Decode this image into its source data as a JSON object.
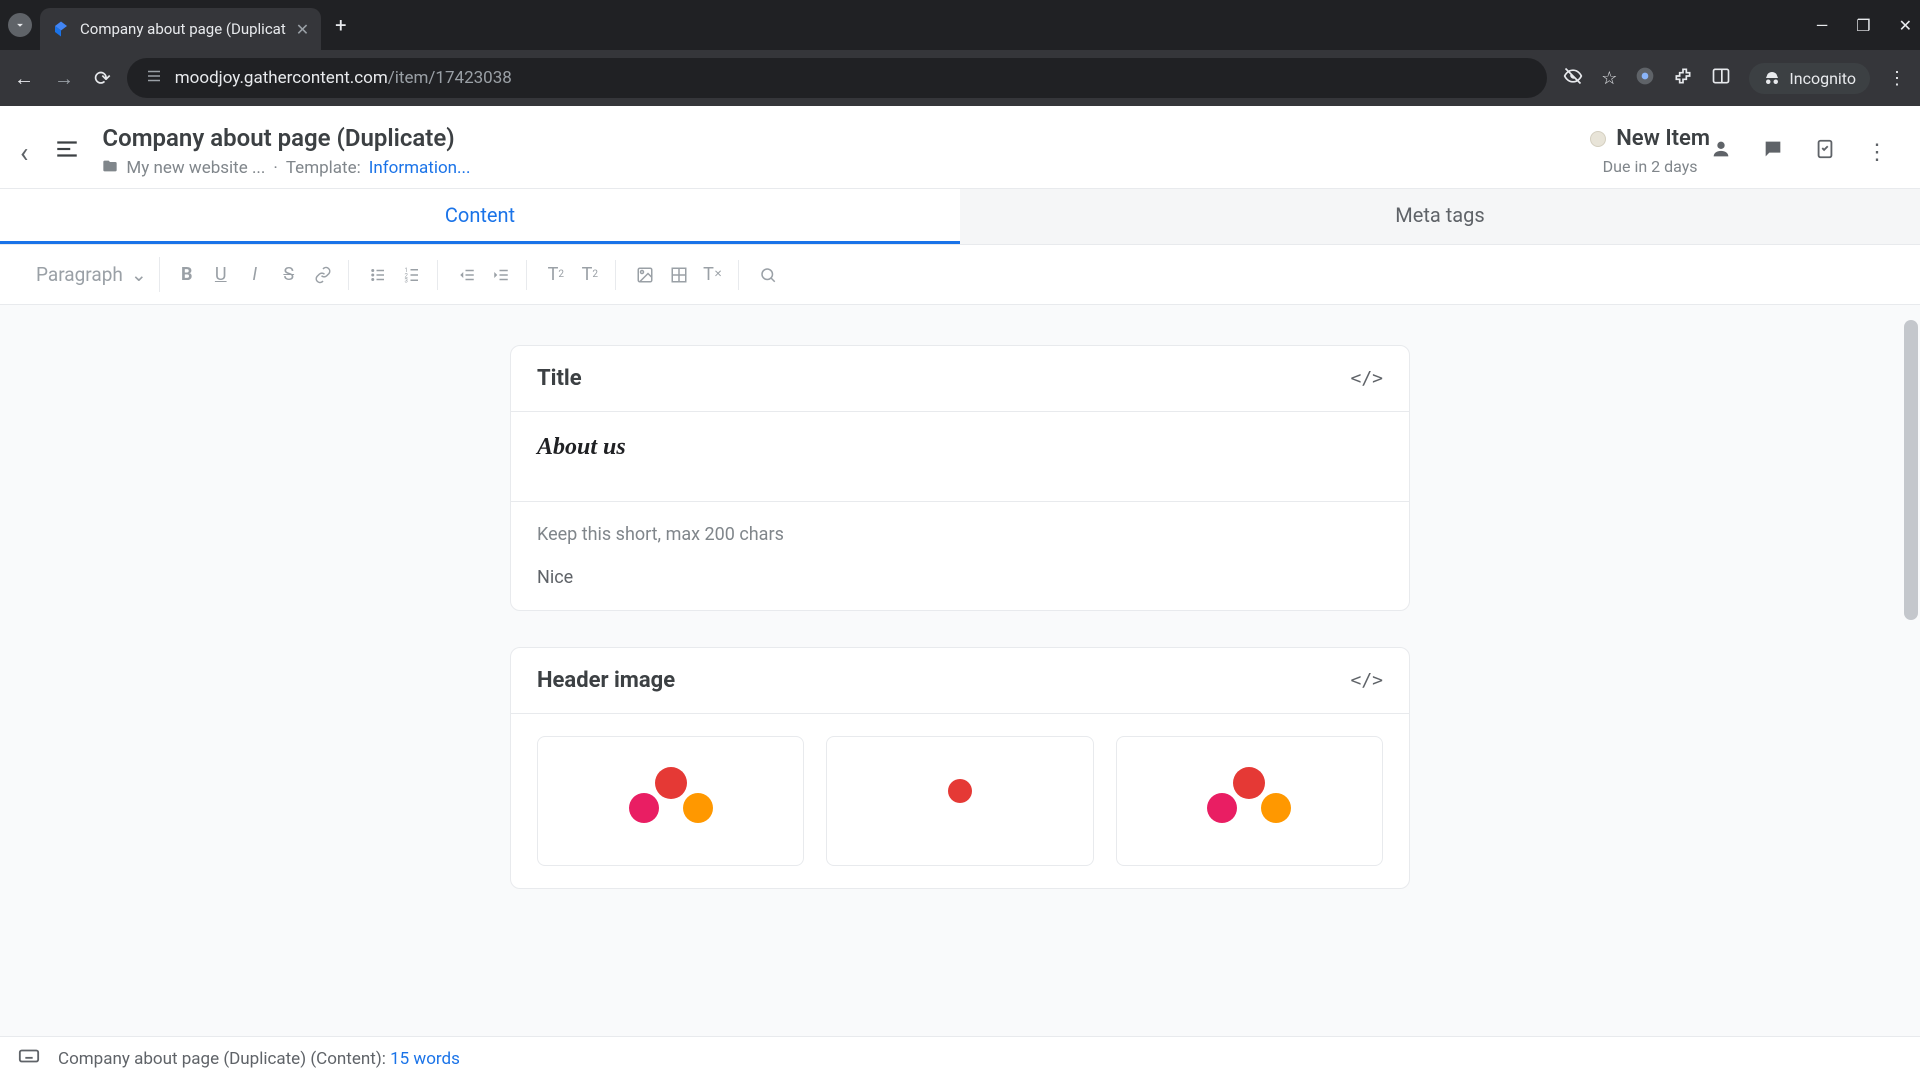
{
  "browser": {
    "tab_title": "Company about page (Duplicat",
    "url_prefix": "moodjoy.gathercontent.com",
    "url_path": "/item/17423038",
    "incognito_label": "Incognito"
  },
  "header": {
    "title": "Company about page (Duplicate)",
    "breadcrumb_folder": "My new website ...",
    "breadcrumb_dot": "·",
    "template_label": "Template:",
    "template_value": "Information...",
    "status_label": "New Item",
    "due_text": "Due in 2 days"
  },
  "tabs": {
    "content": "Content",
    "meta": "Meta tags"
  },
  "toolbar": {
    "paragraph_label": "Paragraph"
  },
  "card_title": {
    "label": "Title",
    "heading": "About us",
    "hint": "Keep this short, max 200 chars",
    "body": "Nice"
  },
  "card_image": {
    "label": "Header image"
  },
  "footer": {
    "text_prefix": "Company about page (Duplicate) (Content): ",
    "word_count": "15 words"
  }
}
